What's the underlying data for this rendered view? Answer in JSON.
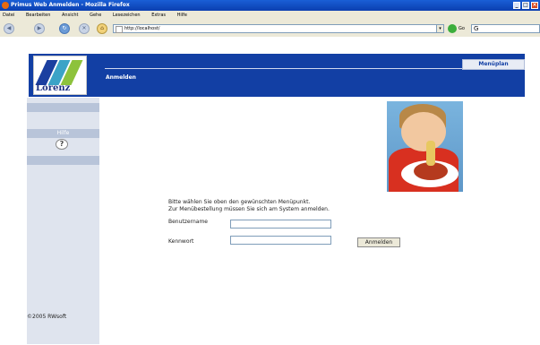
{
  "window": {
    "title": "Primus Web Anmelden - Mozilla Firefox"
  },
  "menu": [
    "Datei",
    "Bearbeiten",
    "Ansicht",
    "Gehe",
    "Lesezeichen",
    "Extras",
    "Hilfe"
  ],
  "nav": {
    "url": "http://localhost/",
    "go_label": "Go",
    "search_placeholder": "G"
  },
  "header": {
    "tab_label": "Menüplan",
    "section_label": "Anmelden",
    "logo_text": "Lorenz"
  },
  "sidebar": {
    "help_label": "Hilfe",
    "help_icon": "?"
  },
  "content": {
    "message_line1": "Bitte wählen Sie oben den gewünschten Menüpunkt.",
    "message_line2": "Zur Menübestellung müssen Sie sich am System anmelden.",
    "username_label": "Benutzername",
    "username_value": "",
    "password_label": "Kennwort",
    "password_value": "",
    "login_button": "Anmelden"
  },
  "footer": {
    "copyright": "©2005 RWsoft"
  },
  "colors": {
    "header_blue": "#123fa4",
    "sidebar_bg": "#dfe4ee",
    "sidebar_band": "#b8c4d9"
  }
}
